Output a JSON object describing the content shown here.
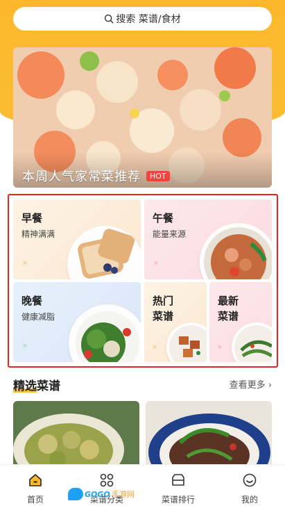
{
  "search": {
    "placeholder": "搜索 菜谱/食材"
  },
  "banner": {
    "title": "本周人气家常菜推荐",
    "badge": "HOT"
  },
  "categories": [
    {
      "title": "早餐",
      "subtitle": "精神满满"
    },
    {
      "title": "午餐",
      "subtitle": "能量来源"
    },
    {
      "title": "晚餐",
      "subtitle": "健康减脂"
    },
    {
      "title": "热门菜谱"
    },
    {
      "title": "最新菜谱"
    }
  ],
  "section": {
    "title": "精选菜谱",
    "more": "查看更多 ›"
  },
  "tabbar": [
    {
      "label": "首页",
      "icon": "home-icon",
      "active": true
    },
    {
      "label": "菜谱分类",
      "icon": "category-grid-icon"
    },
    {
      "label": "菜谱排行",
      "icon": "ranking-box-icon"
    },
    {
      "label": "我的",
      "icon": "profile-smile-icon"
    }
  ],
  "watermark": {
    "brand": "GOGO",
    "suffix": "手游网"
  },
  "colors": {
    "accent": "#fbb82b",
    "highlight": "#e52321",
    "hot": "#f4423c"
  }
}
